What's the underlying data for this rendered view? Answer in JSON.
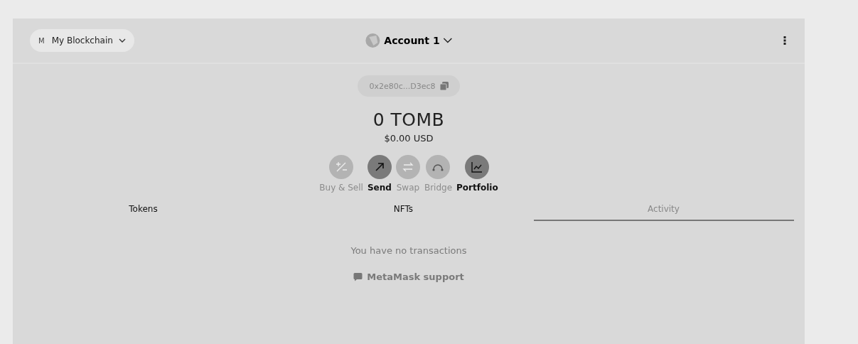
{
  "network": {
    "initial": "M",
    "name": "My Blockchain"
  },
  "account": {
    "name": "Account 1",
    "address": "0x2e80c...D3ec8"
  },
  "balance": {
    "amount": "0 TOMB",
    "fiat": "$0.00 USD"
  },
  "actions": [
    {
      "kind": "buysell",
      "label": "Buy & Sell",
      "disabled": true
    },
    {
      "kind": "send",
      "label": "Send",
      "disabled": false
    },
    {
      "kind": "swap",
      "label": "Swap",
      "disabled": true
    },
    {
      "kind": "bridge",
      "label": "Bridge",
      "disabled": true
    },
    {
      "kind": "portfolio",
      "label": "Portfolio",
      "disabled": false
    }
  ],
  "tabs": [
    {
      "label": "Tokens",
      "selected": false
    },
    {
      "label": "NFTs",
      "selected": false
    },
    {
      "label": "Activity",
      "selected": true
    }
  ],
  "empty_message": "You have no transactions",
  "support_link": "MetaMask support"
}
